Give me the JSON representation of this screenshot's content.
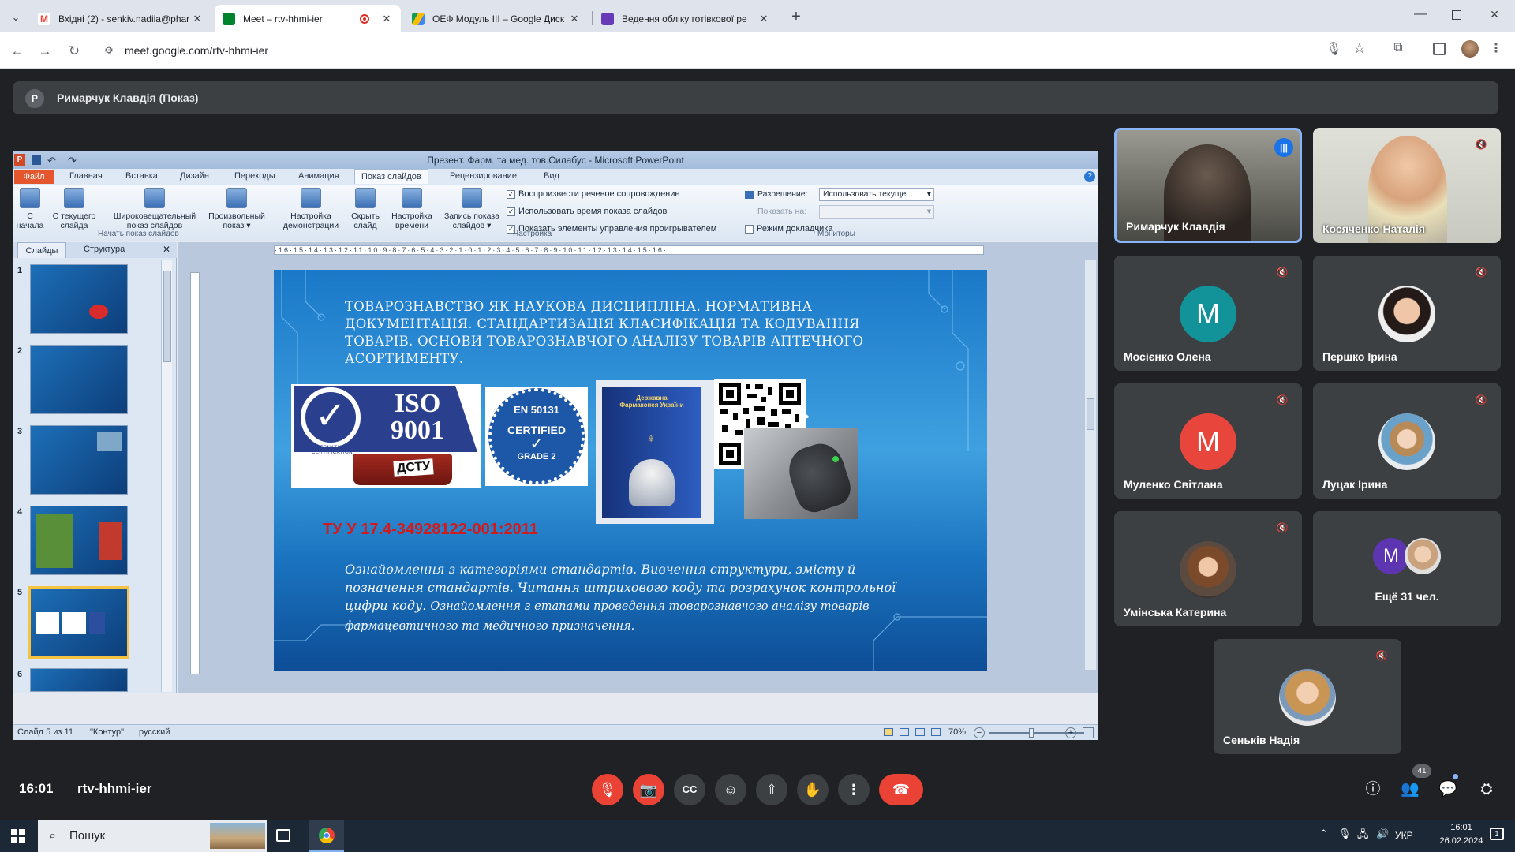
{
  "browser": {
    "tabs": [
      {
        "title": "Вхідні (2) - senkiv.nadiia@phar",
        "icon": "gmail-icon",
        "color": "#ea4335"
      },
      {
        "title": "Meet – rtv-hhmi-ier",
        "icon": "meet-icon",
        "color": "#00832d",
        "recording": true
      },
      {
        "title": "ОЕФ Модуль III – Google Диск",
        "icon": "drive-icon",
        "color": "#fbbc04"
      },
      {
        "title": "Ведення обліку готівкової ре",
        "icon": "forms-icon",
        "color": "#673ab7"
      }
    ],
    "new_tab": "+",
    "url": "meet.google.com/rtv-hhmi-ier"
  },
  "meet": {
    "presenter_initial": "Р",
    "presenter_label": "Римарчук Клавдія (Показ)",
    "time": "16:01",
    "meeting_code": "rtv-hhmi-ier",
    "participants_count": "41"
  },
  "powerpoint": {
    "window_title": "Презент. Фарм. та мед. тов.Силабус - Microsoft PowerPoint",
    "file_tab": "Файл",
    "tabs": [
      "Главная",
      "Вставка",
      "Дизайн",
      "Переходы",
      "Анимация",
      "Показ слайдов",
      "Рецензирование",
      "Вид"
    ],
    "active_tab": "Показ слайдов",
    "ribbon_buttons": [
      {
        "l1": "С",
        "l2": "начала"
      },
      {
        "l1": "С текущего",
        "l2": "слайда"
      },
      {
        "l1": "Широковещательный",
        "l2": "показ слайдов"
      },
      {
        "l1": "Произвольный",
        "l2": "показ ▾"
      },
      {
        "l1": "Настройка",
        "l2": "демонстрации"
      },
      {
        "l1": "Скрыть",
        "l2": "слайд"
      },
      {
        "l1": "Настройка",
        "l2": "времени"
      },
      {
        "l1": "Запись показа",
        "l2": "слайдов ▾"
      }
    ],
    "checkboxes": [
      "Воспроизвести речевое сопровождение",
      "Использовать время показа слайдов",
      "Показать элементы управления проигрывателем"
    ],
    "resolution_label": "Разрешение:",
    "resolution_value": "Использовать текуще...",
    "show_on_label": "Показать на:",
    "presenter_mode": "Режим докладчика",
    "groups": [
      "Начать показ слайдов",
      "Настройка",
      "Мониторы"
    ],
    "pane_tabs": [
      "Слайды",
      "Структура"
    ],
    "thumb_numbers": [
      "1",
      "2",
      "3",
      "4",
      "5",
      "6"
    ],
    "ruler_h": "·16·15·14·13·12·11·10·9·8·7·6·5·4·3·2·1·0·1·2·3·4·5·6·7·8·9·10·11·12·13·14·15·16·",
    "slide": {
      "heading": "Товарознавство як наукова дисципліна. Нормативна документація. Стандартизація класифікація та кодування товарів. Основи товарознавчого аналізу товарів аптечного асортименту.",
      "iso_text": "ISO 9001",
      "iso_ring": "INTERNATIONAL CERTIFICATION",
      "dstu": "ДСТУ",
      "en_badge_top": "EN 50131",
      "en_badge_mid": "CERTIFIED",
      "en_badge_bot": "GRADE 2",
      "pharmacopoeia": "Державна Фармакопея України",
      "tu_code": "ТУ У 17.4-34928122-001:2011",
      "body_lead": "Ознайомлення з категоріями стандартів. Вивчення структури, змісту й позначення стандартів. Читання штрихового коду та розрахунок контрольної цифри коду.",
      "body_tail": "Ознайомлення з етапами проведення товарознавчого аналізу товарів фармацевтичного та медичного призначення."
    },
    "status_slide": "Слайд 5 из 11",
    "status_theme": "\"Контур\"",
    "status_lang": "русский",
    "zoom": "70%"
  },
  "participants": [
    {
      "name": "Римарчук Клавдія",
      "speaking": true
    },
    {
      "name": "Косяченко Наталія"
    },
    {
      "name": "Мосієнко Олена",
      "initial": "М",
      "color": "#12939a"
    },
    {
      "name": "Першко Ірина"
    },
    {
      "name": "Муленко Світлана",
      "initial": "М",
      "color": "#e8453c"
    },
    {
      "name": "Луцак Ірина"
    },
    {
      "name": "Умінська Катерина"
    },
    {
      "name": "Ещё 31 чел.",
      "initial": "М",
      "color": "#5e35b1"
    },
    {
      "name": "Сеньків Надія"
    }
  ],
  "taskbar": {
    "search": "Пошук",
    "lang": "УКР",
    "time": "16:01",
    "date": "26.02.2024"
  }
}
